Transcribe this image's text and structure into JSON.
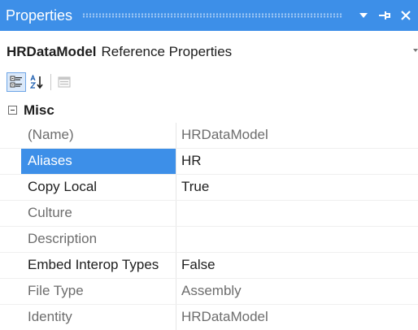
{
  "window": {
    "title": "Properties",
    "buttons": [
      "dropdown-menu",
      "pin",
      "close"
    ]
  },
  "selector": {
    "object_name": "HRDataModel",
    "object_type": "Reference Properties"
  },
  "toolbar": {
    "tools": [
      "categorized",
      "alphabetical",
      "property-pages"
    ],
    "active_tool": "categorized"
  },
  "grid": {
    "category": {
      "label": "Misc",
      "expanded": true
    },
    "rows": [
      {
        "name": "(Name)",
        "value": "HRDataModel",
        "readonly": true,
        "selected": false
      },
      {
        "name": "Aliases",
        "value": "HR",
        "readonly": false,
        "selected": true
      },
      {
        "name": "Copy Local",
        "value": "True",
        "readonly": false,
        "selected": false
      },
      {
        "name": "Culture",
        "value": "",
        "readonly": true,
        "selected": false
      },
      {
        "name": "Description",
        "value": "",
        "readonly": true,
        "selected": false
      },
      {
        "name": "Embed Interop Types",
        "value": "False",
        "readonly": false,
        "selected": false
      },
      {
        "name": "File Type",
        "value": "Assembly",
        "readonly": true,
        "selected": false
      },
      {
        "name": "Identity",
        "value": "HRDataModel",
        "readonly": true,
        "selected": false
      }
    ]
  },
  "colors": {
    "accent": "#3d8fe8",
    "readonly_text": "#6d6d6d",
    "text": "#1e1e1e"
  }
}
